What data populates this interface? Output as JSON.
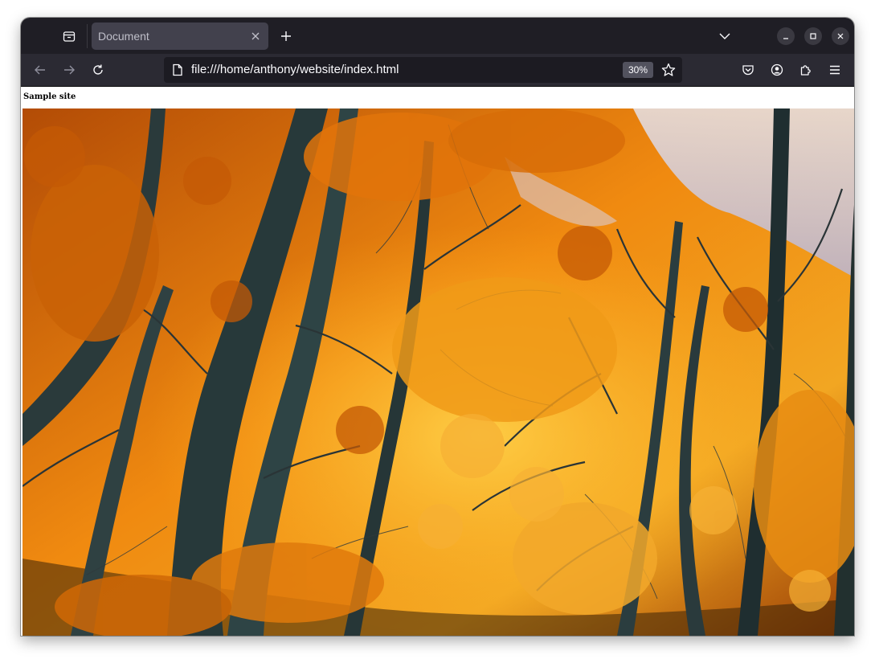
{
  "browser": {
    "tab": {
      "title": "Document"
    },
    "url": "file:///home/anthony/website/index.html",
    "zoom": "30%"
  },
  "page": {
    "site_title": "Sample site",
    "image": {
      "subject": "autumn forest with orange leaves and dark tree trunks"
    }
  },
  "colors": {
    "chrome_dark": "#1f1e25",
    "toolbar": "#2b2a33",
    "urlbar": "#1c1b22",
    "tab_active": "#42414d",
    "icon": "#fbfbfe",
    "leaf_orange": "#e67a0a",
    "trunk_dark": "#2a3a3a"
  },
  "icons": {
    "tab_list": "tab-list-icon",
    "tab_close": "close-icon",
    "new_tab": "plus-icon",
    "all_tabs": "chevron-down-icon",
    "minimize": "minimize-icon",
    "maximize": "maximize-icon",
    "close_window": "close-icon",
    "back": "arrow-left-icon",
    "forward": "arrow-right-icon",
    "reload": "reload-icon",
    "page": "page-icon",
    "bookmark": "star-icon",
    "pocket": "pocket-icon",
    "account": "account-icon",
    "extensions": "puzzle-icon",
    "menu": "hamburger-menu-icon"
  }
}
